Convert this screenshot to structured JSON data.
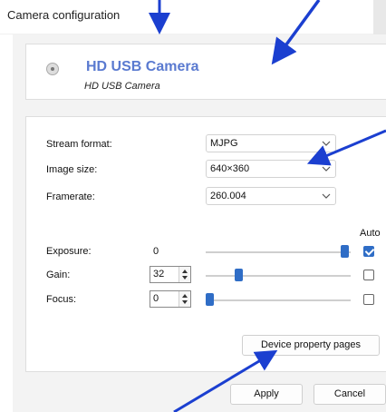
{
  "window": {
    "title": "Camera configuration"
  },
  "device": {
    "name": "HD USB Camera",
    "subtitle": "HD USB Camera"
  },
  "settings": {
    "stream_format": {
      "label": "Stream format:",
      "value": "MJPG"
    },
    "image_size": {
      "label": "Image size:",
      "value": "640×360"
    },
    "framerate": {
      "label": "Framerate:",
      "value": "260.004"
    },
    "auto_label": "Auto",
    "exposure": {
      "label": "Exposure:",
      "value": "0",
      "auto": true,
      "level": 0.99
    },
    "gain": {
      "label": "Gain:",
      "value": "32",
      "auto": false,
      "level": 0.21
    },
    "focus": {
      "label": "Focus:",
      "value": "0",
      "auto": false,
      "level": 0.0
    }
  },
  "buttons": {
    "device_property_pages": "Device property pages",
    "apply": "Apply",
    "cancel": "Cancel"
  },
  "colors": {
    "accent": "#2f6dc6",
    "title_accent": "#5a7ad0",
    "annotation_arrow": "#1b3fd0"
  }
}
